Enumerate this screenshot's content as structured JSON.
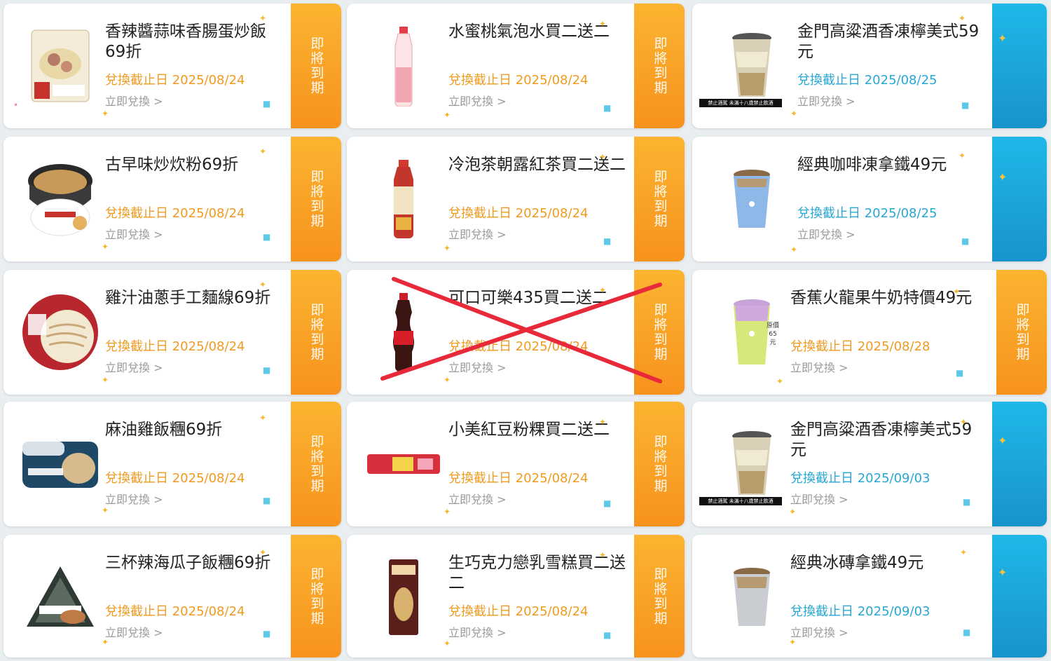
{
  "stub_text": "即將到期",
  "redeem_label": "立即兌換 >",
  "coupons": [
    {
      "title": "香辣醬蒜味香腸蛋炒飯69折",
      "expiry": "兌換截止日 2025/08/24"
    },
    {
      "title": "水蜜桃氣泡水買二送二",
      "expiry": "兌換截止日 2025/08/24"
    },
    {
      "title": "金門高粱酒香凍檸美式59元",
      "expiry": "兌換截止日 2025/08/25"
    },
    {
      "title": "古早味炒炊粉69折",
      "expiry": "兌換截止日 2025/08/24"
    },
    {
      "title": "冷泡茶朝露紅茶買二送二",
      "expiry": "兌換截止日 2025/08/24"
    },
    {
      "title": "經典咖啡凍拿鐵49元",
      "expiry": "兌換截止日 2025/08/25"
    },
    {
      "title": "雞汁油蔥手工麵線69折",
      "expiry": "兌換截止日 2025/08/24"
    },
    {
      "title": "可口可樂435買二送二",
      "expiry": "兌換截止日 2025/08/24"
    },
    {
      "title": "香蕉火龍果牛奶特價49元",
      "expiry": "兌換截止日 2025/08/28"
    },
    {
      "title": "麻油雞飯糰69折",
      "expiry": "兌換截止日 2025/08/24"
    },
    {
      "title": "小美紅豆粉粿買二送二",
      "expiry": "兌換截止日 2025/08/24"
    },
    {
      "title": "金門高粱酒香凍檸美式59元",
      "expiry": "兌換截止日 2025/09/03"
    },
    {
      "title": "三杯辣海瓜子飯糰69折",
      "expiry": "兌換截止日 2025/08/24"
    },
    {
      "title": "生巧克力戀乳雪糕買二送二",
      "expiry": "兌換截止日 2025/08/24"
    },
    {
      "title": "經典冰磚拿鐵49元",
      "expiry": "兌換截止日 2025/09/03"
    }
  ],
  "age_warning": "禁止酒駕 未滿十八歲禁止飲酒",
  "price_note": "原價65元",
  "colors": {
    "orange_accent": "#f7931e",
    "blue_accent": "#1893cc",
    "expiry_orange": "#f19a1f",
    "expiry_blue": "#27a7d6",
    "cross_red": "#e8293a"
  },
  "product_icons": [
    "fried-rice-pack-icon",
    "peach-soda-bottle-icon",
    "iced-drink-cup-icon",
    "noodle-bowl-icon",
    "tea-bottle-icon",
    "blue-latte-cup-icon",
    "noodle-pack-icon",
    "cola-bottle-icon",
    "smoothie-cup-icon",
    "rice-ball-pack-icon",
    "jelly-bar-icon",
    "iced-drink-cup-icon",
    "onigiri-icon",
    "ice-cream-bar-icon",
    "silver-latte-cup-icon"
  ]
}
